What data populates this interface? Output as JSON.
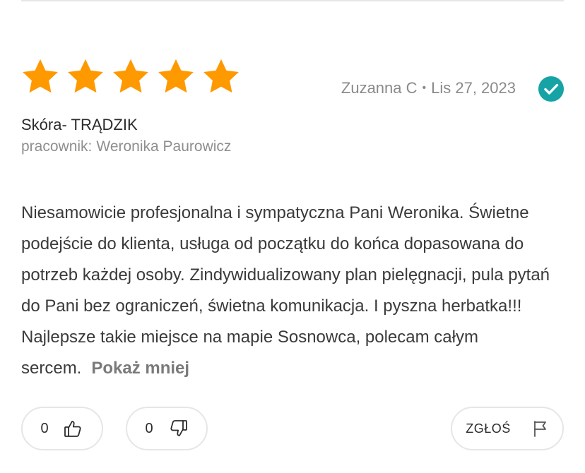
{
  "rating": {
    "value": 5,
    "max": 5,
    "star_color": "#FF9900"
  },
  "review": {
    "author": "Zuzanna C",
    "separator": "•",
    "date": "Lis 27, 2023",
    "verified_color": "#16A3A6",
    "service": "Skóra- TRĄDZIK",
    "employee_label": "pracownik:",
    "employee_name": "Weronika Paurowicz",
    "text": "Niesamowicie profesjonalna i sympatyczna Pani Weronika. Świetne podejście do klienta, usługa od początku do końca dopasowana do potrzeb każdej osoby. Zindywidualizowany plan pielęgnacji, pula pytań do Pani bez ograniczeń, świetna komunikacja. I pyszna herbatka!!! Najlepsze takie miejsce na mapie Sosnowca, polecam całym sercem.",
    "toggle_label": "Pokaż mniej"
  },
  "actions": {
    "thumbs_up_count": "0",
    "thumbs_down_count": "0",
    "report_label": "ZGŁOŚ"
  },
  "icons": [
    "star-icon",
    "verified-check-icon",
    "thumbs-up-icon",
    "thumbs-down-icon",
    "flag-icon"
  ]
}
